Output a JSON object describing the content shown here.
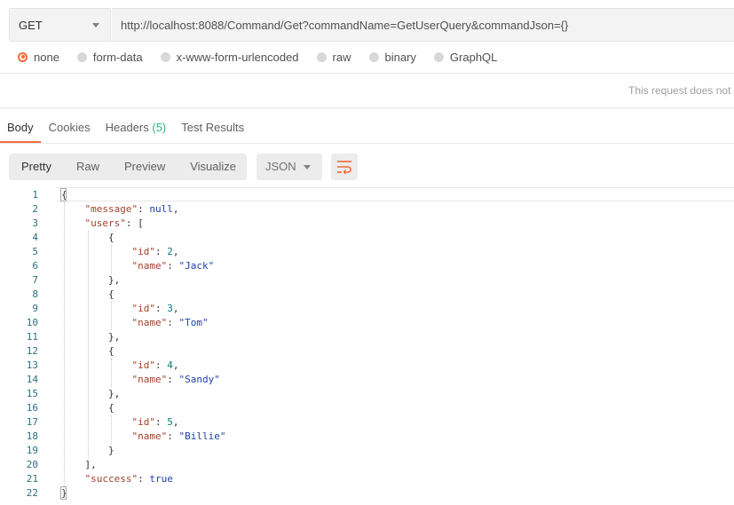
{
  "request": {
    "method": "GET",
    "url": "http://localhost:8088/Command/Get?commandName=GetUserQuery&commandJson={}"
  },
  "body_types": {
    "selected": "none",
    "options": [
      "none",
      "form-data",
      "x-www-form-urlencoded",
      "raw",
      "binary",
      "GraphQL"
    ]
  },
  "request_note": "This request does not",
  "response_tabs": {
    "body": "Body",
    "cookies": "Cookies",
    "headers": "Headers",
    "headers_count": "(5)",
    "test_results": "Test Results"
  },
  "toolbar": {
    "views": [
      "Pretty",
      "Raw",
      "Preview",
      "Visualize"
    ],
    "active_view": "Pretty",
    "format": "JSON",
    "wrap_icon": "wrap-lines-icon"
  },
  "colors": {
    "accent": "#f26b3a",
    "count_green": "#26b47f",
    "json_key": "#a3402b",
    "json_string": "#1f41a8",
    "json_number": "#0b7a7a"
  },
  "code_lines": [
    {
      "n": "1",
      "indent": 0,
      "tokens": [
        [
          "p",
          "{"
        ]
      ]
    },
    {
      "n": "2",
      "indent": 1,
      "tokens": [
        [
          "key",
          "\"message\""
        ],
        [
          "p",
          ": "
        ],
        [
          "kw",
          "null"
        ],
        [
          "p",
          ","
        ]
      ]
    },
    {
      "n": "3",
      "indent": 1,
      "tokens": [
        [
          "key",
          "\"users\""
        ],
        [
          "p",
          ": ["
        ]
      ]
    },
    {
      "n": "4",
      "indent": 2,
      "tokens": [
        [
          "p",
          "{"
        ]
      ]
    },
    {
      "n": "5",
      "indent": 3,
      "tokens": [
        [
          "key",
          "\"id\""
        ],
        [
          "p",
          ": "
        ],
        [
          "num",
          "2"
        ],
        [
          "p",
          ","
        ]
      ]
    },
    {
      "n": "6",
      "indent": 3,
      "tokens": [
        [
          "key",
          "\"name\""
        ],
        [
          "p",
          ": "
        ],
        [
          "str",
          "\"Jack\""
        ]
      ]
    },
    {
      "n": "7",
      "indent": 2,
      "tokens": [
        [
          "p",
          "},"
        ]
      ]
    },
    {
      "n": "8",
      "indent": 2,
      "tokens": [
        [
          "p",
          "{"
        ]
      ]
    },
    {
      "n": "9",
      "indent": 3,
      "tokens": [
        [
          "key",
          "\"id\""
        ],
        [
          "p",
          ": "
        ],
        [
          "num",
          "3"
        ],
        [
          "p",
          ","
        ]
      ]
    },
    {
      "n": "10",
      "indent": 3,
      "tokens": [
        [
          "key",
          "\"name\""
        ],
        [
          "p",
          ": "
        ],
        [
          "str",
          "\"Tom\""
        ]
      ]
    },
    {
      "n": "11",
      "indent": 2,
      "tokens": [
        [
          "p",
          "},"
        ]
      ]
    },
    {
      "n": "12",
      "indent": 2,
      "tokens": [
        [
          "p",
          "{"
        ]
      ]
    },
    {
      "n": "13",
      "indent": 3,
      "tokens": [
        [
          "key",
          "\"id\""
        ],
        [
          "p",
          ": "
        ],
        [
          "num",
          "4"
        ],
        [
          "p",
          ","
        ]
      ]
    },
    {
      "n": "14",
      "indent": 3,
      "tokens": [
        [
          "key",
          "\"name\""
        ],
        [
          "p",
          ": "
        ],
        [
          "str",
          "\"Sandy\""
        ]
      ]
    },
    {
      "n": "15",
      "indent": 2,
      "tokens": [
        [
          "p",
          "},"
        ]
      ]
    },
    {
      "n": "16",
      "indent": 2,
      "tokens": [
        [
          "p",
          "{"
        ]
      ]
    },
    {
      "n": "17",
      "indent": 3,
      "tokens": [
        [
          "key",
          "\"id\""
        ],
        [
          "p",
          ": "
        ],
        [
          "num",
          "5"
        ],
        [
          "p",
          ","
        ]
      ]
    },
    {
      "n": "18",
      "indent": 3,
      "tokens": [
        [
          "key",
          "\"name\""
        ],
        [
          "p",
          ": "
        ],
        [
          "str",
          "\"Billie\""
        ]
      ]
    },
    {
      "n": "19",
      "indent": 2,
      "tokens": [
        [
          "p",
          "}"
        ]
      ]
    },
    {
      "n": "20",
      "indent": 1,
      "tokens": [
        [
          "p",
          "],"
        ]
      ]
    },
    {
      "n": "21",
      "indent": 1,
      "tokens": [
        [
          "key",
          "\"success\""
        ],
        [
          "p",
          ": "
        ],
        [
          "kw",
          "true"
        ]
      ]
    },
    {
      "n": "22",
      "indent": 0,
      "tokens": [
        [
          "p",
          "}"
        ]
      ]
    }
  ]
}
